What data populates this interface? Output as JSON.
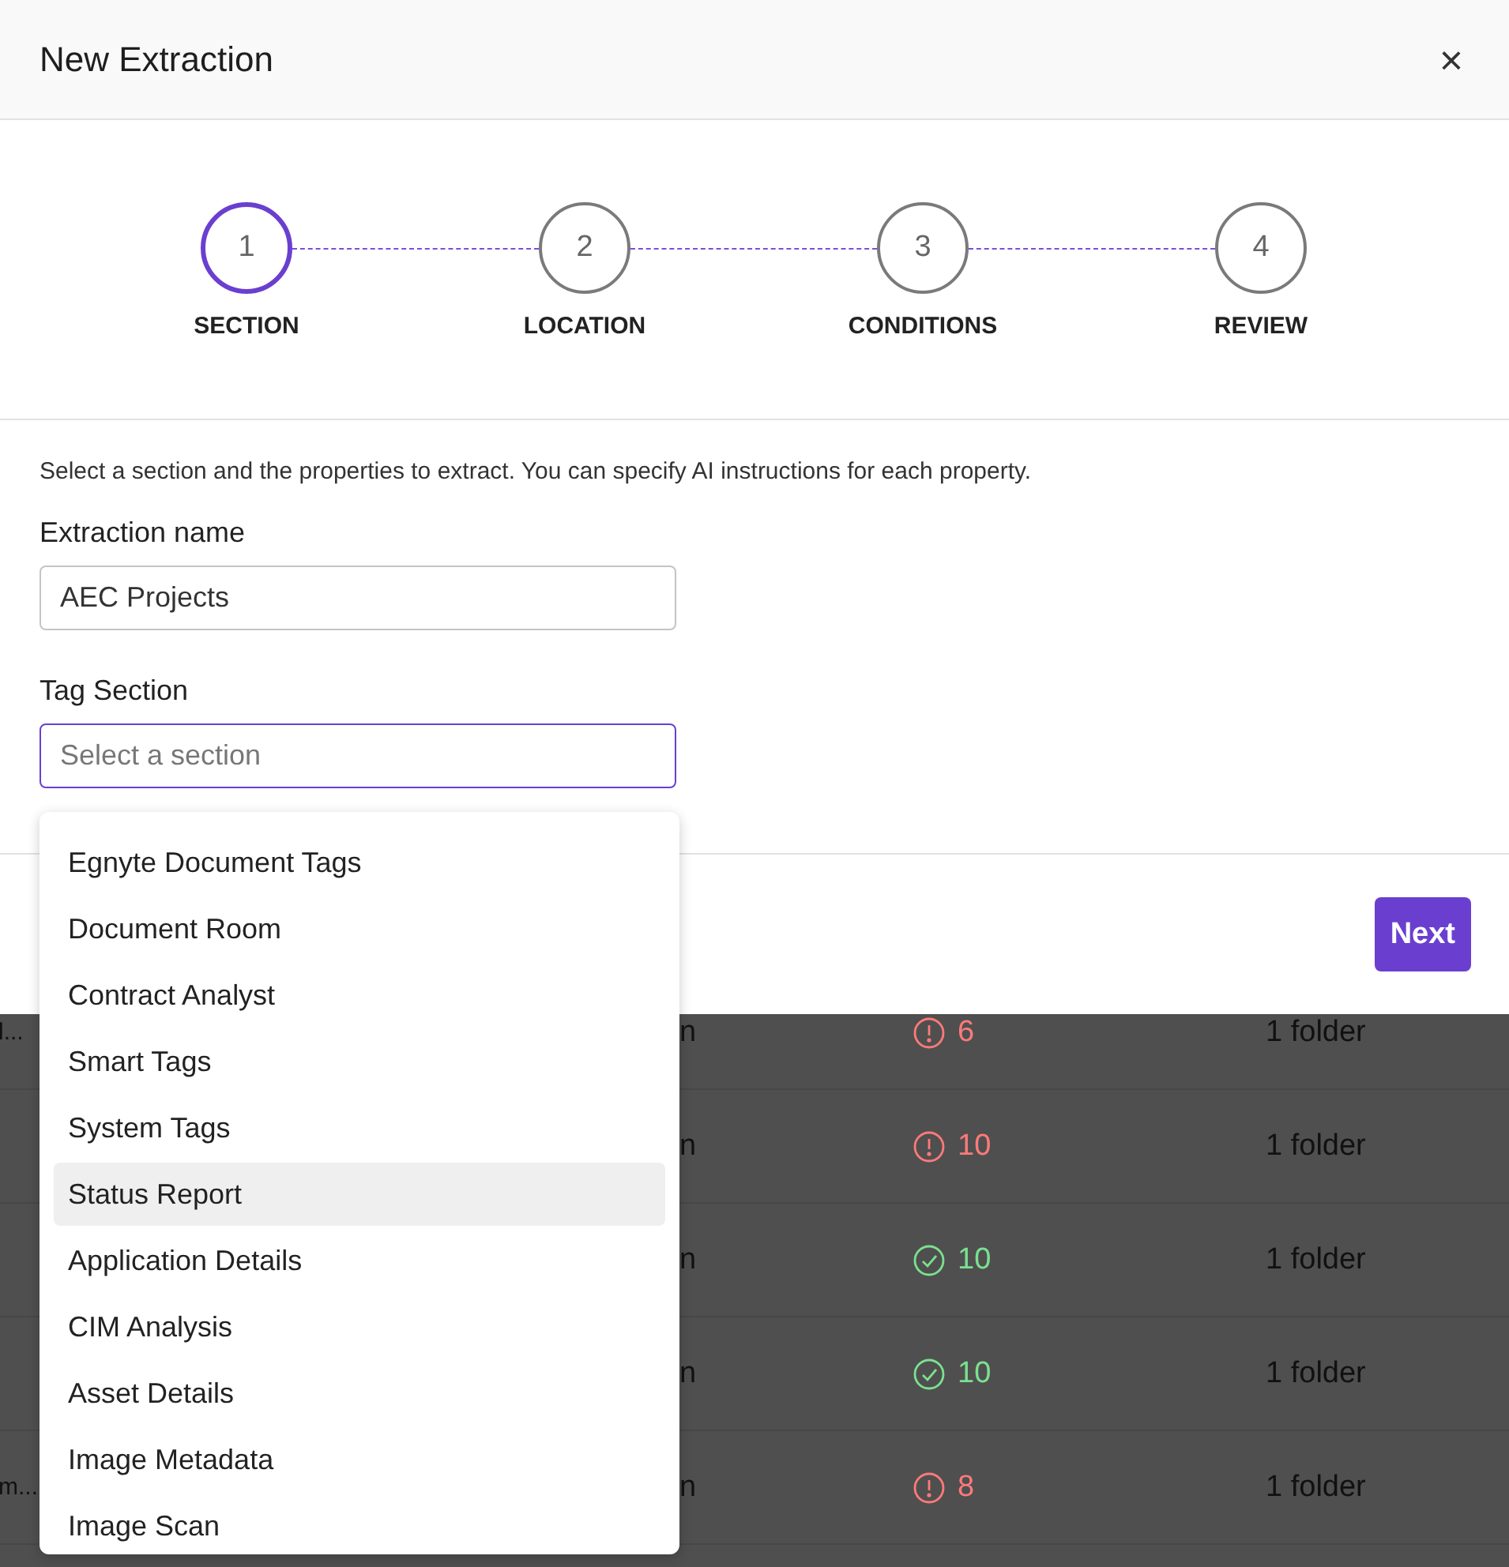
{
  "dialog": {
    "title": "New Extraction",
    "close_label": "×",
    "steps": [
      {
        "number": "1",
        "label": "SECTION",
        "selected": true
      },
      {
        "number": "2",
        "label": "LOCATION",
        "selected": false
      },
      {
        "number": "3",
        "label": "CONDITIONS",
        "selected": false
      },
      {
        "number": "4",
        "label": "REVIEW",
        "selected": false
      }
    ],
    "description": "Select a section and the properties to extract. You can specify AI instructions for each property.",
    "fields": [
      {
        "label": "Extraction name",
        "value": "AEC Projects",
        "focused": false
      },
      {
        "label": "Tag Section",
        "placeholder": "Select a section",
        "focused": true
      }
    ],
    "dropdown_options": [
      {
        "label": "Egnyte Document Tags",
        "selected": false
      },
      {
        "label": "Document Room",
        "selected": false
      },
      {
        "label": "Contract Analyst",
        "selected": false
      },
      {
        "label": "Smart Tags",
        "selected": false
      },
      {
        "label": "System Tags",
        "selected": false
      },
      {
        "label": "Status Report",
        "selected": true
      },
      {
        "label": "Application Details",
        "selected": false
      },
      {
        "label": "CIM Analysis",
        "selected": false
      },
      {
        "label": "Asset Details",
        "selected": false
      },
      {
        "label": "Image Metadata",
        "selected": false
      },
      {
        "label": "Image Scan",
        "selected": false
      }
    ],
    "next_button": "Next"
  },
  "background_table": {
    "rows": [
      {
        "column_1": "l...",
        "column_2": "n",
        "kind": "error",
        "count": "6",
        "location": "1 folder"
      },
      {
        "column_2": "n",
        "kind": "error",
        "count": "10",
        "location": "1 folder"
      },
      {
        "column_2": "n",
        "kind": "ok",
        "count": "10",
        "location": "1 folder"
      },
      {
        "column_2": "n",
        "kind": "ok",
        "count": "10",
        "location": "1 folder"
      },
      {
        "column_1": "m...",
        "column_2": "n",
        "kind": "error",
        "count": "8",
        "location": "1 folder"
      }
    ]
  }
}
